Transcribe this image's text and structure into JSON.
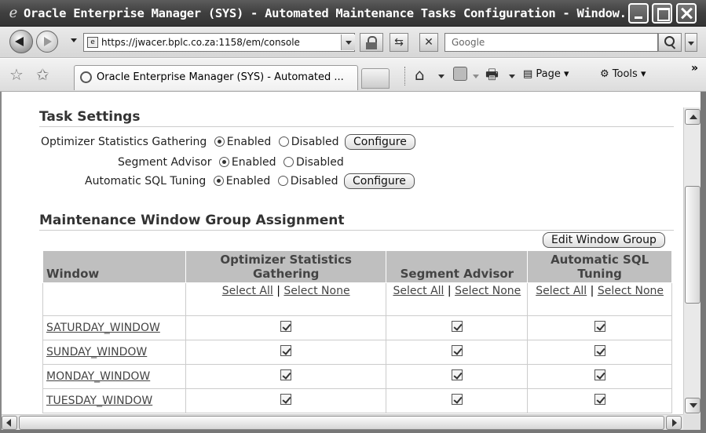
{
  "window": {
    "title": "Oracle Enterprise Manager (SYS) - Automated Maintenance Tasks Configuration - Window..."
  },
  "address_bar": {
    "url": "https://jwacer.bplc.co.za:1158/em/console",
    "search_placeholder": "Google"
  },
  "tab": {
    "label": "Oracle Enterprise Manager (SYS) - Automated ..."
  },
  "command_bar": {
    "page_label": "Page",
    "tools_label": "Tools"
  },
  "task_settings": {
    "title": "Task Settings",
    "enabled_label": "Enabled",
    "disabled_label": "Disabled",
    "configure_label": "Configure",
    "rows": [
      {
        "label": "Optimizer Statistics Gathering",
        "state": "Enabled",
        "has_configure": true
      },
      {
        "label": "Segment Advisor",
        "state": "Enabled",
        "has_configure": false
      },
      {
        "label": "Automatic SQL Tuning",
        "state": "Enabled",
        "has_configure": true
      }
    ]
  },
  "window_groups": {
    "title": "Maintenance Window Group Assignment",
    "edit_button": "Edit Window Group",
    "columns": [
      "Window",
      "Optimizer Statistics Gathering",
      "Segment Advisor",
      "Automatic SQL Tuning"
    ],
    "select_all": "Select All",
    "select_none": "Select None",
    "separator": "|",
    "rows": [
      {
        "window": "SATURDAY_WINDOW",
        "checks": [
          true,
          true,
          true
        ]
      },
      {
        "window": "SUNDAY_WINDOW",
        "checks": [
          true,
          true,
          true
        ]
      },
      {
        "window": "MONDAY_WINDOW",
        "checks": [
          true,
          true,
          true
        ]
      },
      {
        "window": "TUESDAY_WINDOW",
        "checks": [
          true,
          true,
          true
        ]
      }
    ]
  }
}
